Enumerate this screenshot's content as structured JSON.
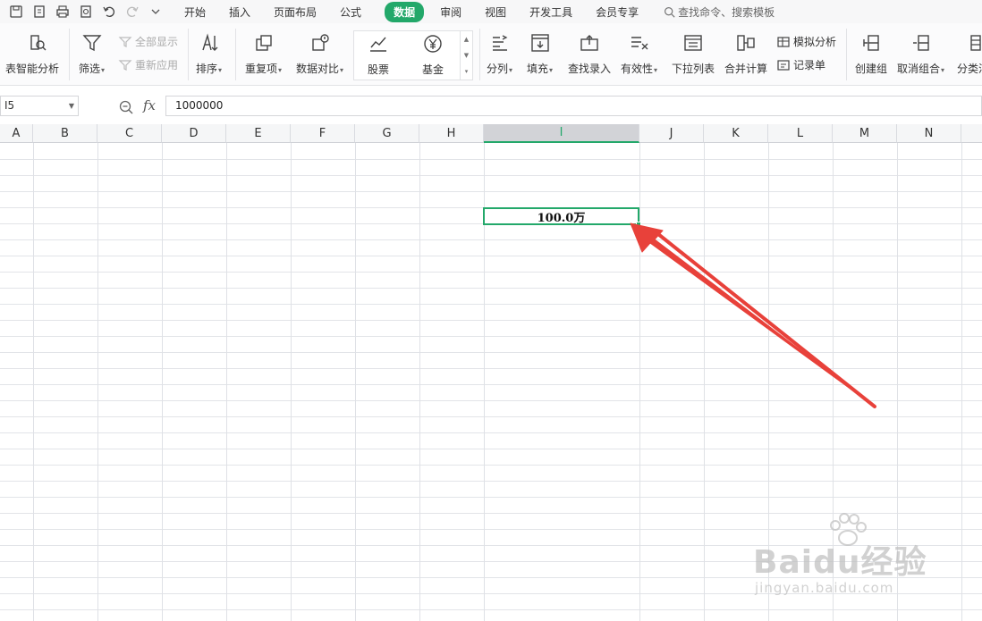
{
  "menubar": {
    "tabs": [
      "开始",
      "插入",
      "页面布局",
      "公式",
      "数据",
      "审阅",
      "视图",
      "开发工具",
      "会员专享"
    ],
    "active_tab": "数据",
    "search_label": "查找命令、搜索模板"
  },
  "ribbon": {
    "partial_left": "表",
    "smart_analysis": "智能分析",
    "filter": "筛选",
    "show_all": "全部显示",
    "reapply": "重新应用",
    "sort": "排序",
    "duplicates": "重复项",
    "data_compare": "数据对比",
    "stock": "股票",
    "fund": "基金",
    "split": "分列",
    "fill": "填充",
    "lookup_entry": "查找录入",
    "validity": "有效性",
    "dropdown_list": "下拉列表",
    "consolidate": "合并计算",
    "simulation": "模拟分析",
    "record_form": "记录单",
    "create_group": "创建组",
    "ungroup": "取消组合",
    "subtotal_partial": "分类汇"
  },
  "formula_bar": {
    "name_box": "I5",
    "fx_label": "fx",
    "formula": "1000000"
  },
  "columns": [
    "A",
    "B",
    "C",
    "D",
    "E",
    "F",
    "G",
    "H",
    "I",
    "J",
    "K",
    "L",
    "M",
    "N"
  ],
  "selected_column": "I",
  "cell": {
    "display": "100.0万"
  },
  "colors": {
    "accent": "#23a86a",
    "arrow": "#e8413a"
  },
  "watermark": {
    "brand": "Baidu经验",
    "url": "jingyan.baidu.com"
  }
}
